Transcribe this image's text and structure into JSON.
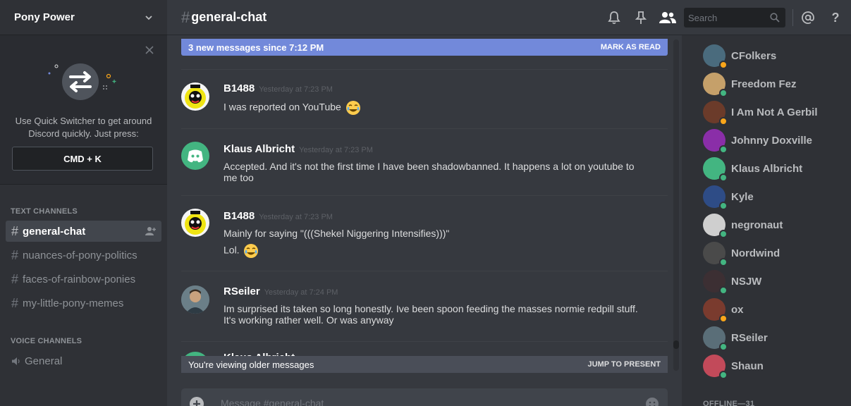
{
  "server": {
    "name": "Pony Power"
  },
  "quick_switcher": {
    "text": "Use Quick Switcher to get around Discord quickly. Just press:",
    "shortcut": "CMD + K"
  },
  "categories": {
    "text": "Text Channels",
    "voice": "Voice Channels"
  },
  "text_channels": [
    {
      "name": "general-chat",
      "active": true
    },
    {
      "name": "nuances-of-pony-politics"
    },
    {
      "name": "faces-of-rainbow-ponies"
    },
    {
      "name": "my-little-pony-memes"
    }
  ],
  "voice_channels": [
    {
      "name": "General"
    }
  ],
  "header": {
    "hash": "#",
    "channel": "general-chat"
  },
  "search": {
    "placeholder": "Search"
  },
  "banners": {
    "new_messages": "3 new messages since 7:12 PM",
    "mark_as_read": "MARK AS READ",
    "older": "You're viewing older messages",
    "jump": "JUMP TO PRESENT"
  },
  "messages": [
    {
      "author": "B1488",
      "timestamp": "Yesterday at 7:23 PM",
      "lines": [
        "I was reported on YouTube"
      ],
      "emoji": "joy"
    },
    {
      "author": "Klaus Albricht",
      "timestamp": "Yesterday at 7:23 PM",
      "lines": [
        "Accepted. And it's not the first time I have been shadowbanned. It happens a lot on youtube to",
        "me too"
      ]
    },
    {
      "author": "B1488",
      "timestamp": "Yesterday at 7:23 PM",
      "lines": [
        "Mainly for saying \"(((Shekel Niggering Intensifies)))\"",
        "Lol."
      ],
      "emoji": "joy"
    },
    {
      "author": "RSeiler",
      "timestamp": "Yesterday at 7:24 PM",
      "lines": [
        "Im surprised its taken so long honestly.  Ive been spoon feeding the masses normie redpill stuff.",
        "It's working rather well.  Or was anyway"
      ]
    },
    {
      "author": "Klaus Albricht"
    }
  ],
  "composer": {
    "placeholder": "Message #general-chat"
  },
  "members": [
    {
      "name": "CFolkers",
      "status": "idle",
      "color": "#4a6b7d"
    },
    {
      "name": "Freedom Fez",
      "status": "online",
      "color": "#c5a06a"
    },
    {
      "name": "I Am Not A Gerbil",
      "status": "idle",
      "color": "#6b3b2a"
    },
    {
      "name": "Johnny Doxville",
      "status": "online",
      "color": "#8a2ea8"
    },
    {
      "name": "Klaus Albricht",
      "status": "online",
      "color": "#43b581"
    },
    {
      "name": "Kyle",
      "status": "online",
      "color": "#2e4c86"
    },
    {
      "name": "negronaut",
      "status": "online",
      "color": "#cfcfcf"
    },
    {
      "name": "Nordwind",
      "status": "online",
      "color": "#4a4a4a"
    },
    {
      "name": "NSJW",
      "status": "online",
      "color": "#3c2f33"
    },
    {
      "name": "ox",
      "status": "idle",
      "color": "#7a3b2e"
    },
    {
      "name": "RSeiler",
      "status": "online",
      "color": "#5a6e78"
    },
    {
      "name": "Shaun",
      "status": "online",
      "color": "#c24a5a"
    }
  ],
  "offline_label": "OFFLINE—31",
  "colors": {
    "online": "#43b581",
    "idle": "#faa61a",
    "blurple": "#7289da"
  }
}
